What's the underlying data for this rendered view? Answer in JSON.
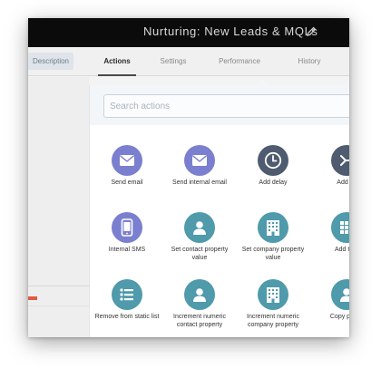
{
  "window": {
    "title": "Nurturing: New Leads & MQLs"
  },
  "tabs": [
    {
      "label": "Description"
    },
    {
      "label": "Actions"
    },
    {
      "label": "Settings"
    },
    {
      "label": "Performance"
    },
    {
      "label": "History"
    }
  ],
  "search": {
    "placeholder": "Search actions"
  },
  "actions": [
    {
      "label": "Send email",
      "icon": "envelope-icon",
      "color": "#7b7fcf"
    },
    {
      "label": "Send internal email",
      "icon": "envelope-icon",
      "color": "#7b7fcf"
    },
    {
      "label": "Add delay",
      "icon": "clock-icon",
      "color": "#4f5b6e"
    },
    {
      "label": "Add Br",
      "icon": "branch-icon",
      "color": "#4f5b6e"
    },
    {
      "label": "Internal SMS",
      "icon": "phone-icon",
      "color": "#7b7fcf"
    },
    {
      "label": "Set contact property value",
      "icon": "person-icon",
      "color": "#4f9aab"
    },
    {
      "label": "Set company property value",
      "icon": "building-icon",
      "color": "#4f9aab"
    },
    {
      "label": "Add to a",
      "icon": "grid-icon",
      "color": "#4f9aab"
    },
    {
      "label": "Remove from static list",
      "icon": "list-icon",
      "color": "#4f9aab"
    },
    {
      "label": "Increment numeric contact property",
      "icon": "person-icon",
      "color": "#4f9aab"
    },
    {
      "label": "Increment numeric company property",
      "icon": "building-icon",
      "color": "#4f9aab"
    },
    {
      "label": "Copy prope",
      "icon": "person-icon",
      "color": "#4f9aab"
    }
  ]
}
